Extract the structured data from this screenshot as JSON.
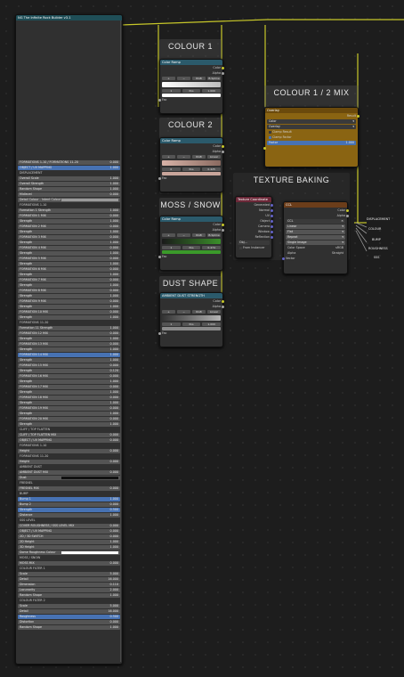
{
  "group_node": {
    "title": "NG The Infinite Rock Builder v3.1",
    "rows": [
      {
        "label": "FORMATIONS 1-10 / FORMATIONS 11-20",
        "value": "0.000",
        "hi": false
      },
      {
        "label": "OBJECT / UV MAPPING",
        "value": "1.000",
        "hi": true
      },
      {
        "label": "DISPLACEMENT",
        "value": "",
        "plain": true
      },
      {
        "label": "Overall Scale",
        "value": "1.000"
      },
      {
        "label": "Overall Strength",
        "value": "1.000"
      },
      {
        "label": "Random Shape",
        "value": "1.000"
      },
      {
        "label": "Midlevel",
        "value": "0.000"
      },
      {
        "label": "Detail Colour - Intent Colour",
        "value": "",
        "swatch": "#9a9a9a"
      },
      {
        "label": "FORMATIONS 1-10",
        "value": "",
        "plain": true
      },
      {
        "label": "Formation 1 Strength",
        "value": "1.000"
      },
      {
        "label": "FORMATION 1 MIX",
        "value": "0.000"
      },
      {
        "label": "Strength",
        "value": "1.000"
      },
      {
        "label": "FORMATION 2 MIX",
        "value": "0.000"
      },
      {
        "label": "Strength",
        "value": "1.000"
      },
      {
        "label": "FORMATION 3 MIX",
        "value": "0.000"
      },
      {
        "label": "Strength",
        "value": "1.000"
      },
      {
        "label": "FORMATION 4 MIX",
        "value": "0.000"
      },
      {
        "label": "Strength",
        "value": "1.000"
      },
      {
        "label": "FORMATION 5 MIX",
        "value": "0.000"
      },
      {
        "label": "Strength",
        "value": "1.000"
      },
      {
        "label": "FORMATION 6 MIX",
        "value": "0.000"
      },
      {
        "label": "Strength",
        "value": "1.000"
      },
      {
        "label": "FORMATION 7 MIX",
        "value": "0.000"
      },
      {
        "label": "Strength",
        "value": "1.000"
      },
      {
        "label": "FORMATION 8 MIX",
        "value": "0.000"
      },
      {
        "label": "Strength",
        "value": "1.000"
      },
      {
        "label": "FORMATION 9 MIX",
        "value": "0.000"
      },
      {
        "label": "Strength",
        "value": "1.000"
      },
      {
        "label": "FORMATION 10 MIX",
        "value": "0.000"
      },
      {
        "label": "Strength",
        "value": "1.000"
      },
      {
        "label": "FORMATIONS 11-20",
        "value": "",
        "plain": true
      },
      {
        "label": "Formation 11 Strength",
        "value": "1.000"
      },
      {
        "label": "FORMATION 12 MIX",
        "value": "0.000"
      },
      {
        "label": "Strength",
        "value": "1.000"
      },
      {
        "label": "FORMATION 13 MIX",
        "value": "0.000"
      },
      {
        "label": "Strength",
        "value": "1.000"
      },
      {
        "label": "FORMATION 14 MIX",
        "value": "1.000",
        "hi": true
      },
      {
        "label": "Strength",
        "value": "1.000"
      },
      {
        "label": "FORMATION 15 MIX",
        "value": "0.000"
      },
      {
        "label": "Strength",
        "value": "0.120"
      },
      {
        "label": "FORMATION 16 MIX",
        "value": "0.000"
      },
      {
        "label": "Strength",
        "value": "1.000"
      },
      {
        "label": "FORMATION 17 MIX",
        "value": "0.000"
      },
      {
        "label": "Strength",
        "value": "1.000"
      },
      {
        "label": "FORMATION 18 MIX",
        "value": "0.000"
      },
      {
        "label": "Strength",
        "value": "1.000"
      },
      {
        "label": "FORMATION 19 MIX",
        "value": "0.000"
      },
      {
        "label": "Strength",
        "value": "1.000"
      },
      {
        "label": "FORMATION 20 MIX",
        "value": "0.000"
      },
      {
        "label": "Strength",
        "value": "1.000"
      },
      {
        "label": "CLIFF / TOP FLATTEN",
        "value": "",
        "plain": true
      },
      {
        "label": "CLIFF / TOP FLATTEN MIX",
        "value": "0.000"
      },
      {
        "label": "OBJECT / UV MAPPING",
        "value": "0.000"
      },
      {
        "label": "FORMATIONS 1-10",
        "value": "",
        "plain": true
      },
      {
        "label": "Height",
        "value": "0.000"
      },
      {
        "label": "FORMATIONS 11-20",
        "value": "",
        "plain": true
      },
      {
        "label": "Height",
        "value": "0.000"
      },
      {
        "label": "AMBIENT DUST",
        "value": "",
        "plain": true
      },
      {
        "label": "AMBIENT DUST MIX",
        "value": "0.000"
      },
      {
        "label": "Dust",
        "value": "",
        "swatch": "#111111"
      },
      {
        "label": "FRESNEL",
        "value": "",
        "plain": true
      },
      {
        "label": "FRESNEL MIX",
        "value": "0.000"
      },
      {
        "label": "BUMP",
        "value": "",
        "plain": true
      },
      {
        "label": "Bump 1",
        "value": "1.000",
        "hi": true
      },
      {
        "label": "Bump 2",
        "value": "0.000"
      },
      {
        "label": "Strength",
        "value": "0.500",
        "hi": true
      },
      {
        "label": "Distance",
        "value": "1.000"
      },
      {
        "label": "SSS LEVEL",
        "value": "",
        "plain": true
      },
      {
        "label": "COVER ROUGHNESS / SSS LEVEL MIX",
        "value": "0.000"
      },
      {
        "label": "OBJECT / UV MAPPING",
        "value": "0.000"
      },
      {
        "label": "2D / 3D SWITCH",
        "value": "0.000"
      },
      {
        "label": "2D Height",
        "value": "1.000"
      },
      {
        "label": "3D Height",
        "value": "1.000"
      },
      {
        "label": "Dome Roughness Colour",
        "value": "",
        "swatch": "#ffffff"
      },
      {
        "label": "MOSS / SNOW",
        "value": "",
        "plain": true
      },
      {
        "label": "MOSS MIX",
        "value": "0.000"
      },
      {
        "label": "COLOUR FILTER 1",
        "value": "",
        "plain": true
      },
      {
        "label": "Scale",
        "value": "5.000"
      },
      {
        "label": "Detail",
        "value": "16.000"
      },
      {
        "label": "Dimension",
        "value": "0.110"
      },
      {
        "label": "Lacunarity",
        "value": "2.000"
      },
      {
        "label": "Random Shape",
        "value": "1.000"
      },
      {
        "label": "COLOUR FILTER 2",
        "value": "",
        "plain": true
      },
      {
        "label": "Scale",
        "value": "5.000"
      },
      {
        "label": "Detail",
        "value": "16.000"
      },
      {
        "label": "Roughness",
        "value": "0.500",
        "hi": true
      },
      {
        "label": "Distortion",
        "value": "0.000"
      },
      {
        "label": "Random Shape",
        "value": "1.000"
      }
    ]
  },
  "frames": {
    "colour1": "COLOUR 1",
    "colour2": "COLOUR 2",
    "moss": "MOSS / SNOW",
    "dust": "DUST SHAPE",
    "mix": "COLOUR 1 / 2 MIX",
    "baking": "TEXTURE BAKING"
  },
  "ramp_nodes": [
    {
      "title": "Color Ramp",
      "out1": "Color",
      "out2": "Alpha",
      "mode": "RGB",
      "interp": "B-Spline",
      "index": "1",
      "pos_label": "Pos",
      "pos": "1.000",
      "in": "Fac",
      "ramp": "linear-gradient(90deg,#ffffff,#bdbdbd)"
    },
    {
      "title": "Color Ramp",
      "out1": "Color",
      "out2": "Alpha",
      "mode": "RGB",
      "interp": "Linear",
      "index": "0",
      "pos_label": "Pos",
      "pos": "0.425",
      "in": "Fac",
      "ramp": "linear-gradient(90deg,#d8b3a8,#8a6a60)"
    },
    {
      "title": "Color Ramp",
      "out1": "Color",
      "out2": "Alpha",
      "mode": "RGB",
      "interp": "B-Spline",
      "index": "1",
      "pos_label": "Pos",
      "pos": "0.474",
      "in": "Fac",
      "ramp": "linear-gradient(90deg,#1a1a1a,#3b8f2a)"
    },
    {
      "title": "AMBIENT DUST STRENGTH",
      "out1": "Color",
      "out2": "Alpha",
      "mode": "RGB",
      "interp": "Linear",
      "index": "1",
      "pos_label": "Pos",
      "pos": "1.000",
      "in": "Fac",
      "ramp": "linear-gradient(90deg,#333333,#b5b5b5)"
    }
  ],
  "mix_node": {
    "title": "Overlay",
    "result": "Result",
    "opt1": "Color",
    "opt2": "Overlay",
    "clamp_result": "Clamp Result",
    "clamp_factor": "Clamp Factor",
    "factor_label": "Factor",
    "factor": "1.000"
  },
  "texcoord_node": {
    "title": "Texture Coordinate",
    "outputs": [
      "Generated",
      "Normal",
      "UV",
      "Object",
      "Camera",
      "Window",
      "Reflection"
    ],
    "obj_label": "Obj...",
    "from_inst": "From Instancer"
  },
  "image_node": {
    "title": "CCL",
    "name": "CCL",
    "out1": "Color",
    "out2": "Alpha",
    "interp": "Linear",
    "proj": "Flat",
    "ext": "Repeat",
    "source": "Single Image",
    "cs_label": "Color Space",
    "cs": "sRGB",
    "alpha_label": "Alpha",
    "alpha": "Straight",
    "in": "Vector"
  },
  "outputs": {
    "o1": "DISPLACEMENT",
    "o2": "COLOUR",
    "o3": "BUMP",
    "o4": "ROUGHNESS",
    "o5": "SSS"
  }
}
